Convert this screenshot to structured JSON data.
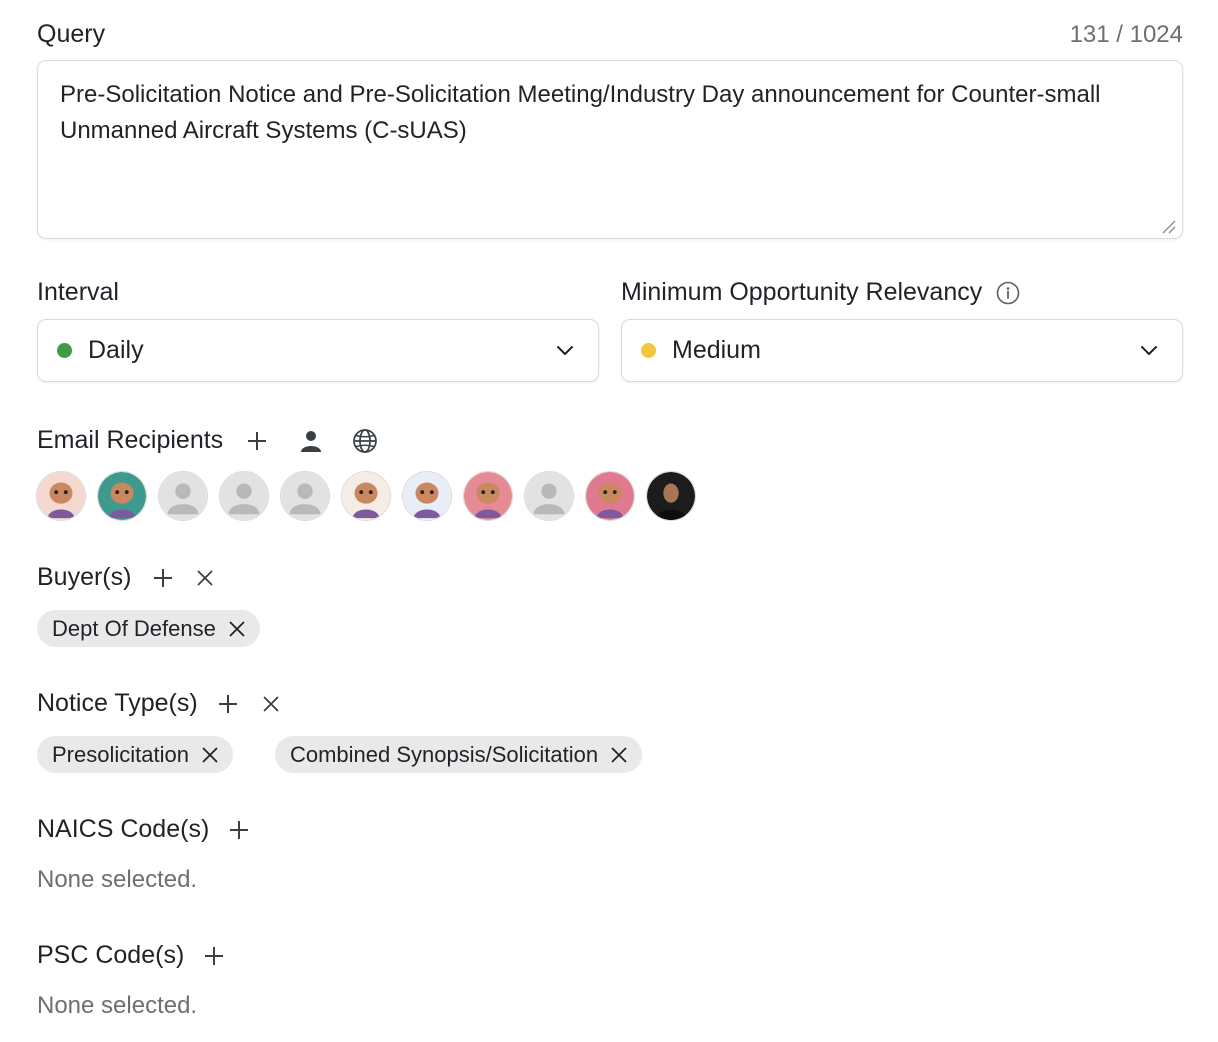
{
  "query": {
    "label": "Query",
    "char_count": "131 / 1024",
    "value": "Pre-Solicitation Notice and Pre-Solicitation Meeting/Industry Day announcement for Counter-small Unmanned Aircraft Systems (C-sUAS)"
  },
  "interval": {
    "label": "Interval",
    "value": "Daily",
    "status_color": "#3f9a48"
  },
  "relevancy": {
    "label": "Minimum Opportunity Relevancy",
    "value": "Medium",
    "status_color": "#f2c83a",
    "info_icon": "info-icon"
  },
  "email_recipients": {
    "label": "Email Recipients",
    "icons": [
      "plus-icon",
      "person-icon",
      "globe-icon"
    ],
    "avatars": [
      {
        "name": "avatar-shrimp",
        "type": "illustrated",
        "color": "#f3d9cf"
      },
      {
        "name": "avatar-teal-character",
        "type": "illustrated",
        "color": "#3e9a8c"
      },
      {
        "name": "avatar-placeholder",
        "type": "placeholder",
        "color": "#e2e2e2"
      },
      {
        "name": "avatar-placeholder",
        "type": "placeholder",
        "color": "#e2e2e2"
      },
      {
        "name": "avatar-placeholder",
        "type": "placeholder",
        "color": "#e2e2e2"
      },
      {
        "name": "avatar-sloth-aviator",
        "type": "illustrated",
        "color": "#f4ede5"
      },
      {
        "name": "avatar-party-character",
        "type": "illustrated",
        "color": "#e8eef7"
      },
      {
        "name": "avatar-sloth-pink",
        "type": "illustrated",
        "color": "#e58b93"
      },
      {
        "name": "avatar-placeholder",
        "type": "placeholder",
        "color": "#e2e2e2"
      },
      {
        "name": "avatar-dj-character",
        "type": "illustrated",
        "color": "#e07a90"
      },
      {
        "name": "avatar-photo",
        "type": "photo",
        "color": "#1c1c1c"
      }
    ]
  },
  "buyers": {
    "label": "Buyer(s)",
    "chips": [
      "Dept Of Defense"
    ]
  },
  "notice_types": {
    "label": "Notice Type(s)",
    "chips": [
      "Presolicitation",
      "Combined Synopsis/Solicitation"
    ]
  },
  "naics": {
    "label": "NAICS Code(s)",
    "empty_text": "None selected."
  },
  "psc": {
    "label": "PSC Code(s)",
    "empty_text": "None selected."
  }
}
